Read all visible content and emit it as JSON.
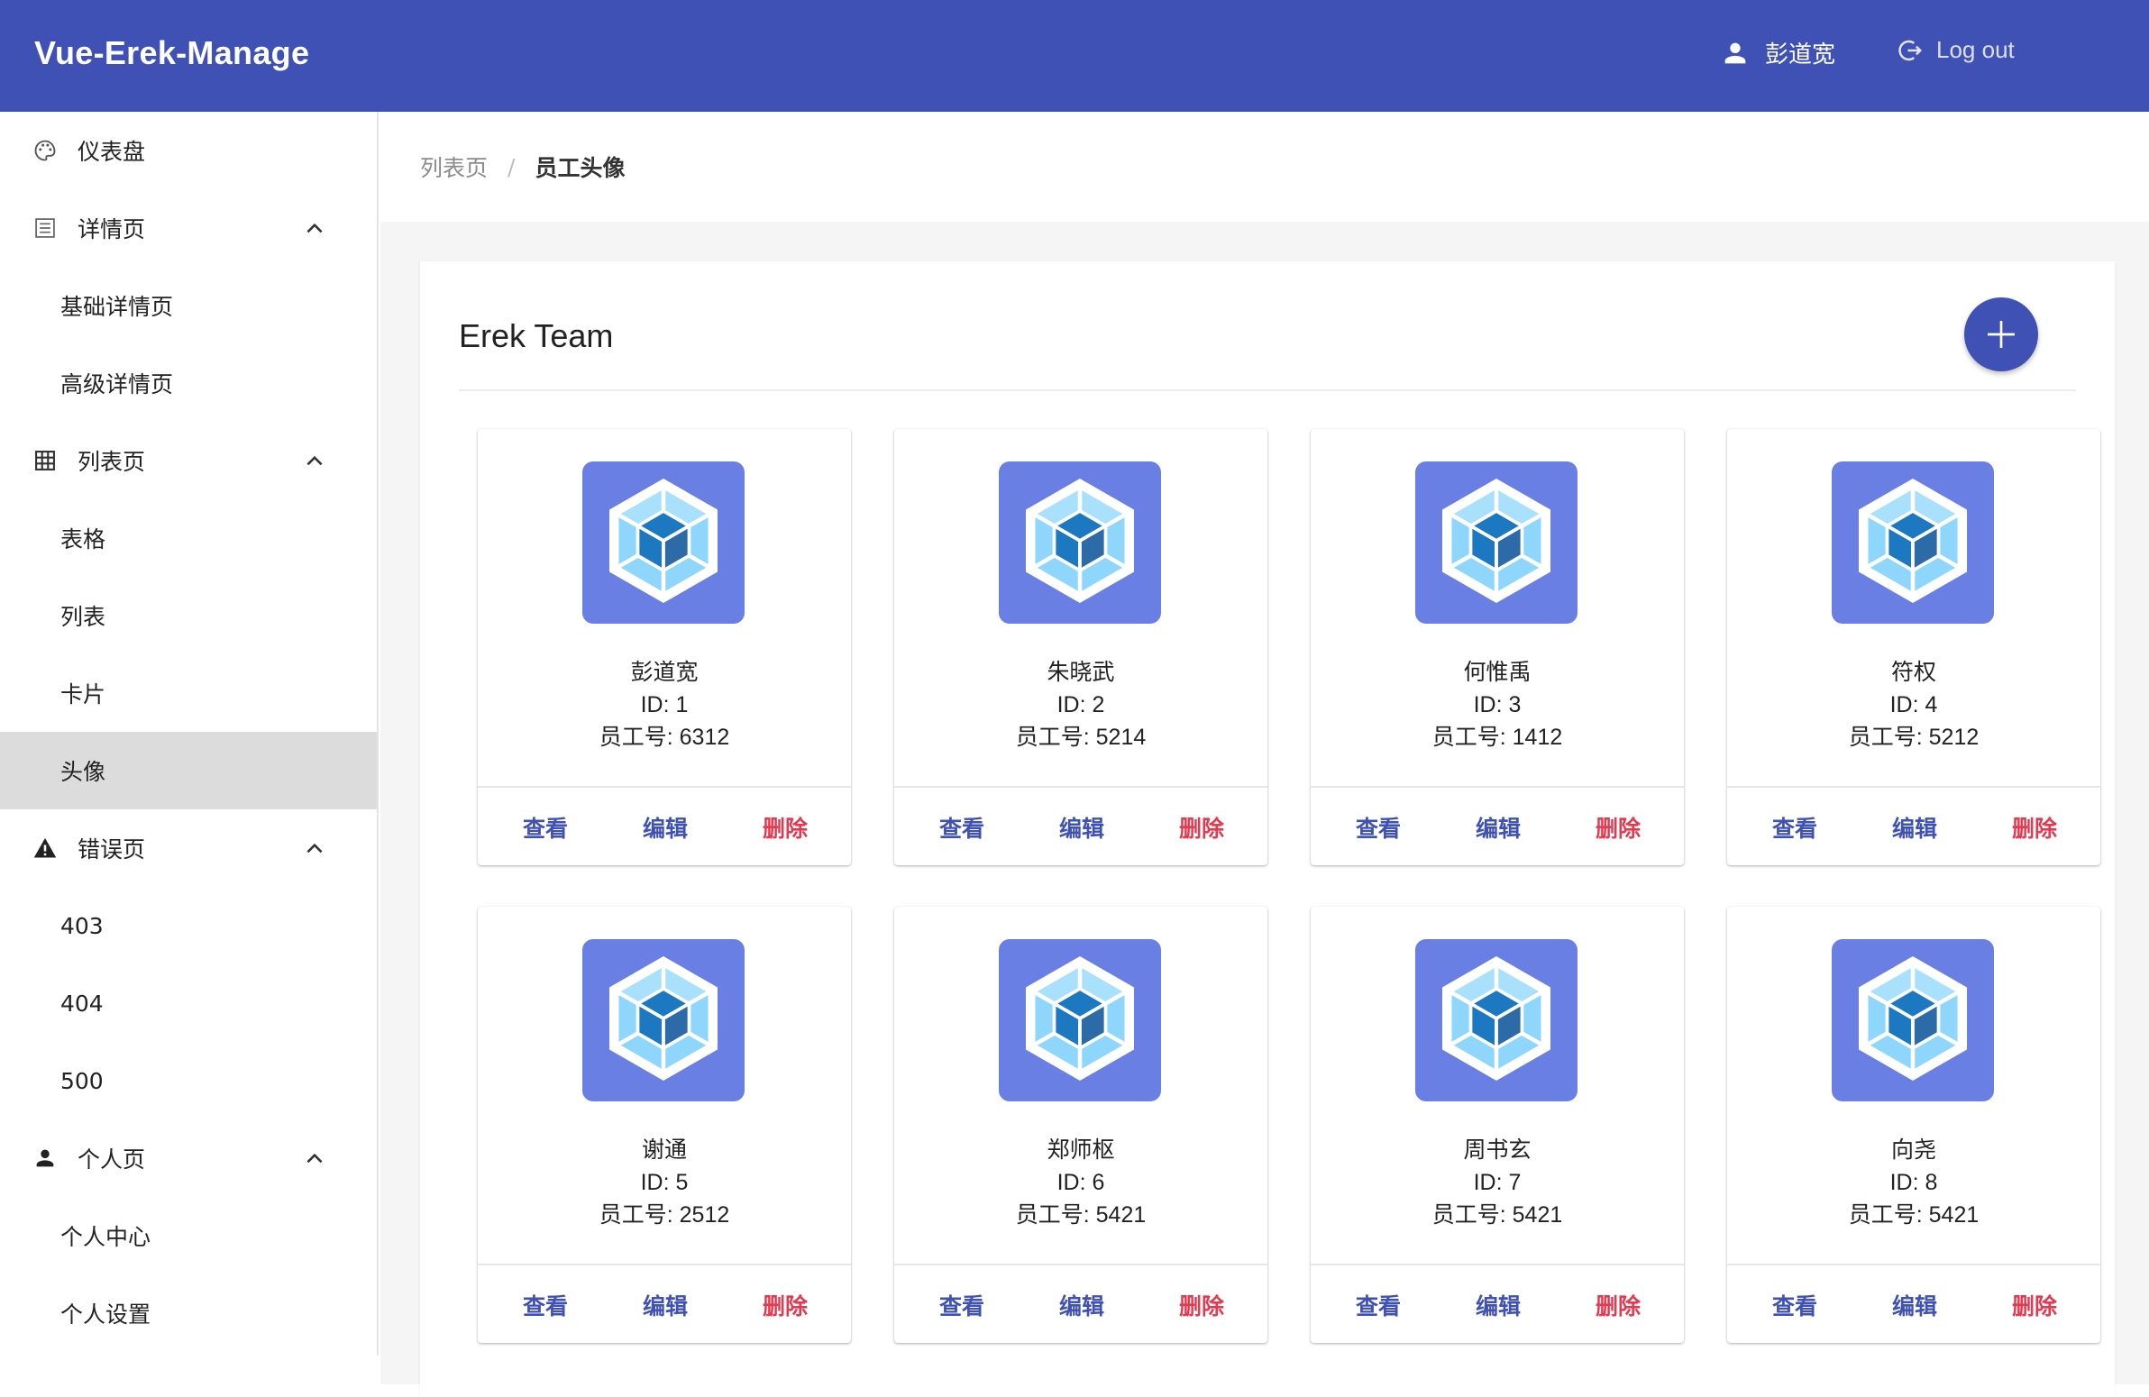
{
  "header": {
    "brand": "Vue-Erek-Manage",
    "user_name": "彭道宽",
    "logout_label": "Log out"
  },
  "sidebar": {
    "items": [
      {
        "type": "group",
        "label": "仪表盘",
        "icon": "palette-icon",
        "chevron": false
      },
      {
        "type": "group",
        "label": "详情页",
        "icon": "list-icon",
        "chevron": true
      },
      {
        "type": "child",
        "label": "基础详情页"
      },
      {
        "type": "child",
        "label": "高级详情页"
      },
      {
        "type": "group",
        "label": "列表页",
        "icon": "grid-icon",
        "chevron": true
      },
      {
        "type": "child",
        "label": "表格"
      },
      {
        "type": "child",
        "label": "列表"
      },
      {
        "type": "child",
        "label": "卡片"
      },
      {
        "type": "child",
        "label": "头像",
        "active": true
      },
      {
        "type": "group",
        "label": "错误页",
        "icon": "warning-icon",
        "chevron": true
      },
      {
        "type": "child",
        "label": "403"
      },
      {
        "type": "child",
        "label": "404"
      },
      {
        "type": "child",
        "label": "500"
      },
      {
        "type": "group",
        "label": "个人页",
        "icon": "person-icon",
        "chevron": true
      },
      {
        "type": "child",
        "label": "个人中心"
      },
      {
        "type": "child",
        "label": "个人设置"
      }
    ]
  },
  "breadcrumb": {
    "parent": "列表页",
    "separator": "/",
    "current": "员工头像"
  },
  "panel": {
    "title": "Erek Team",
    "add_icon": "plus-icon"
  },
  "card_labels": {
    "id_prefix": "ID: ",
    "emp_prefix": "员工号: ",
    "view": "查看",
    "edit": "编辑",
    "delete": "删除"
  },
  "members": [
    {
      "name": "彭道宽",
      "id": "1",
      "emp_no": "6312"
    },
    {
      "name": "朱晓武",
      "id": "2",
      "emp_no": "5214"
    },
    {
      "name": "何惟禹",
      "id": "3",
      "emp_no": "1412"
    },
    {
      "name": "符权",
      "id": "4",
      "emp_no": "5212"
    },
    {
      "name": "谢通",
      "id": "5",
      "emp_no": "2512"
    },
    {
      "name": "郑师枢",
      "id": "6",
      "emp_no": "5421"
    },
    {
      "name": "周书玄",
      "id": "7",
      "emp_no": "5421"
    },
    {
      "name": "向尧",
      "id": "8",
      "emp_no": "5421"
    }
  ],
  "colors": {
    "primary": "#3f51b5",
    "avatar_bg": "#6a7fe3",
    "danger": "#e53950"
  }
}
